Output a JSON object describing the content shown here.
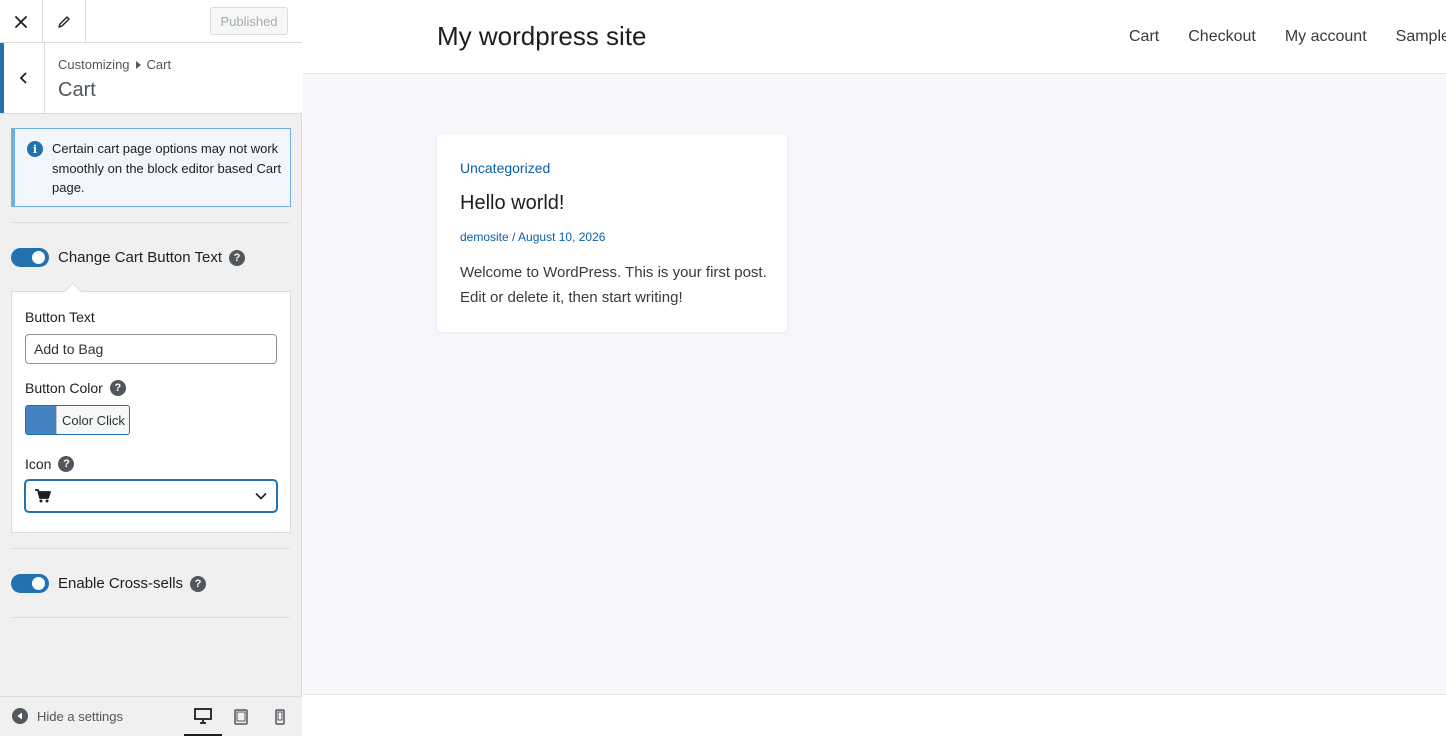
{
  "sidebar": {
    "published_label": "Published",
    "breadcrumb": {
      "root": "Customizing",
      "current": "Cart"
    },
    "section_title": "Cart",
    "notice_text": "Certain cart page options may not work smoothly on the block editor based Cart page.",
    "change_button_text": {
      "label": "Change Cart Button Text",
      "enabled": true
    },
    "button_text": {
      "label": "Button Text",
      "value": "Add to Bag"
    },
    "button_color": {
      "label": "Button Color",
      "button_label": "Color Click",
      "swatch": "#4482c2"
    },
    "icon_field": {
      "label": "Icon",
      "selected": "cart-icon"
    },
    "cross_sells": {
      "label": "Enable Cross-sells",
      "enabled": true
    },
    "footer": {
      "hide_label": "Hide a settings",
      "active_device": "desktop"
    }
  },
  "preview": {
    "site_title": "My wordpress site",
    "nav": [
      "Cart",
      "Checkout",
      "My account",
      "Sample Page"
    ],
    "post": {
      "category": "Uncategorized",
      "title": "Hello world!",
      "author": "demosite",
      "separator": " / ",
      "date": "August 10, 2026",
      "excerpt": "Welcome to WordPress. This is your first post. Edit or delete it, then start writing!"
    }
  },
  "colors": {
    "accent": "#2271b1",
    "link": "#0a5ea8",
    "preview_bg": "#f5f7fb"
  }
}
